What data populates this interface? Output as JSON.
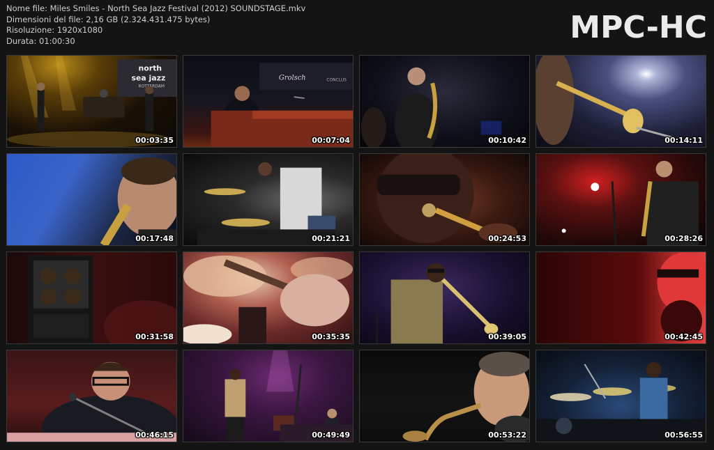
{
  "info": {
    "filename_line": "Nome file: Miles Smiles - North Sea Jazz Festival (2012) SOUNDSTAGE.mkv",
    "filesize_line": "Dimensioni del file: 2,16 GB (2.324.431.475 bytes)",
    "resolution_line": "Risoluzione: 1920x1080",
    "duration_line": "Durata: 01:00:30"
  },
  "logo": "MPC-HC",
  "thumbnails": [
    {
      "timestamp": "00:03:35",
      "scene": "s1"
    },
    {
      "timestamp": "00:07:04",
      "scene": "s2"
    },
    {
      "timestamp": "00:10:42",
      "scene": "s3"
    },
    {
      "timestamp": "00:14:11",
      "scene": "s4"
    },
    {
      "timestamp": "00:17:48",
      "scene": "s5"
    },
    {
      "timestamp": "00:21:21",
      "scene": "s6"
    },
    {
      "timestamp": "00:24:53",
      "scene": "s7"
    },
    {
      "timestamp": "00:28:26",
      "scene": "s8"
    },
    {
      "timestamp": "00:31:58",
      "scene": "s9"
    },
    {
      "timestamp": "00:35:35",
      "scene": "s10"
    },
    {
      "timestamp": "00:39:05",
      "scene": "s11"
    },
    {
      "timestamp": "00:42:45",
      "scene": "s12"
    },
    {
      "timestamp": "00:46:15",
      "scene": "s13"
    },
    {
      "timestamp": "00:49:49",
      "scene": "s14"
    },
    {
      "timestamp": "00:53:22",
      "scene": "s15"
    },
    {
      "timestamp": "00:56:55",
      "scene": "s16"
    }
  ],
  "thumb1_sign": [
    "north",
    "sea jazz",
    "ROTTERDAM"
  ],
  "thumb2_sign": [
    "Grolsch",
    "CONCLUS"
  ]
}
